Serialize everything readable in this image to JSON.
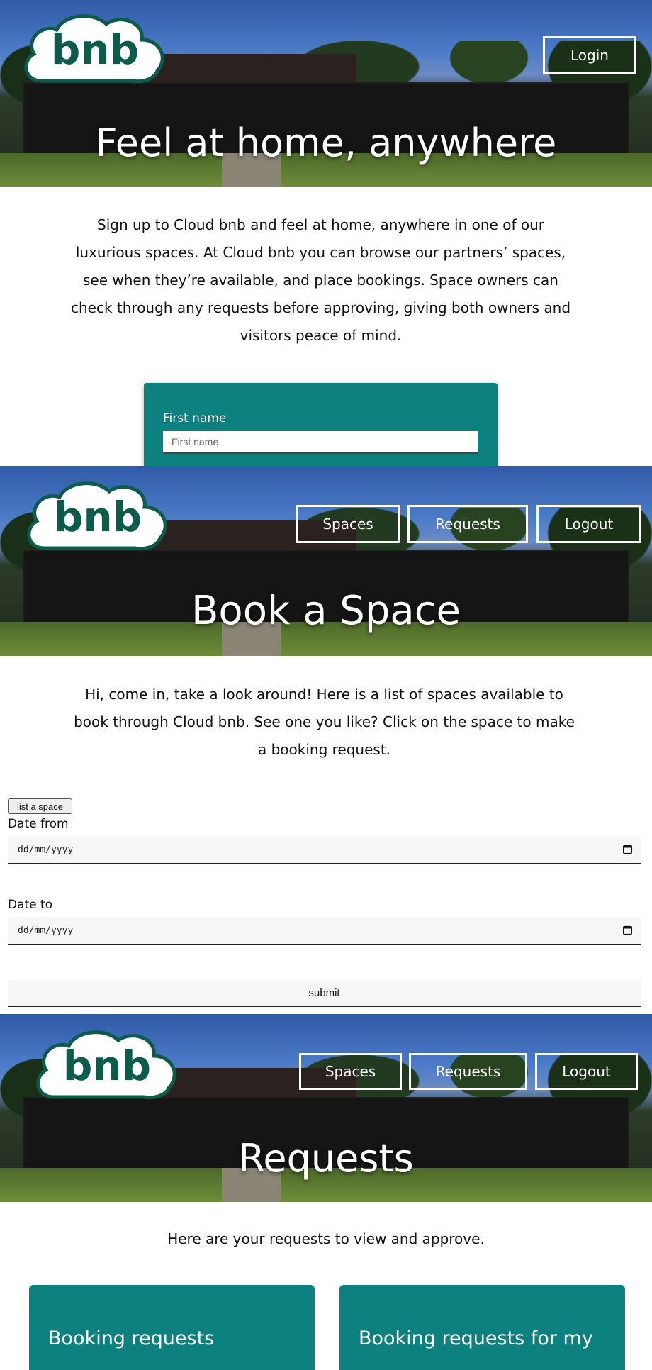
{
  "brand": {
    "logo_text": "bnb",
    "logo_color": "#0d5b4b",
    "accent": "#0d8080"
  },
  "home": {
    "login_label": "Login",
    "hero_title": "Feel at home, anywhere",
    "intro_lines": [
      "Sign up to Cloud bnb and feel at home, anywhere in one of our",
      "luxurious spaces. At Cloud bnb you can browse our partners’ spaces,",
      "see when they’re available, and place bookings. Space owners can",
      "check through any requests before approving, giving both owners and",
      "visitors peace of mind."
    ],
    "form": {
      "first_name_label": "First name",
      "first_name_placeholder": "First name"
    }
  },
  "nav": {
    "spaces": "Spaces",
    "requests": "Requests",
    "logout": "Logout"
  },
  "spaces_page": {
    "hero_title": "Book a Space",
    "intro_lines": [
      "Hi, come in, take a look around! Here is a list of spaces available to",
      "book through Cloud bnb. See one you like? Click on the space to make",
      "a booking request."
    ],
    "list_space_button": "list a space",
    "date_from_label": "Date from",
    "date_from_value": "dd/mm/yyyy",
    "date_to_label": "Date to",
    "date_to_value": "dd/mm/yyyy",
    "submit_label": "submit"
  },
  "requests_page": {
    "hero_title": "Requests",
    "intro": "Here are your requests to view and approve.",
    "cards": [
      "Booking requests",
      "Booking requests for my"
    ]
  }
}
